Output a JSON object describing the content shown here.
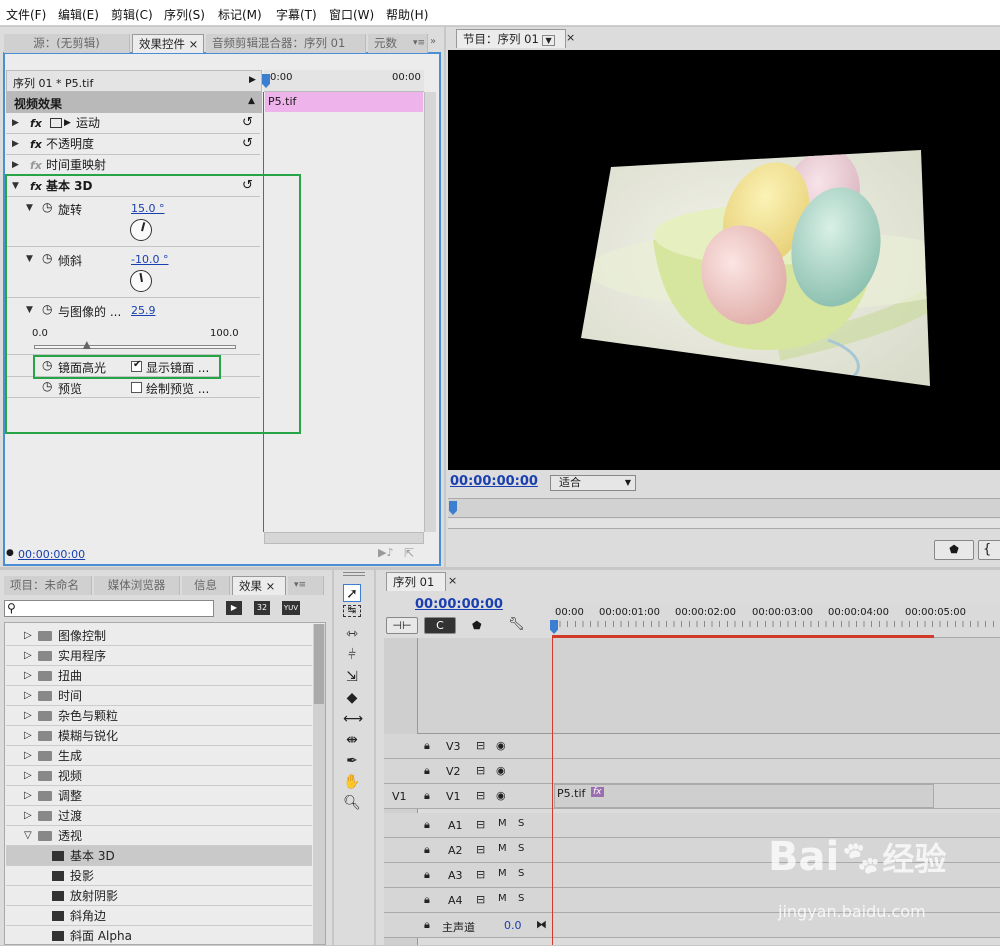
{
  "menu": [
    "文件(F)",
    "编辑(E)",
    "剪辑(C)",
    "序列(S)",
    "标记(M)",
    "字幕(T)",
    "窗口(W)",
    "帮助(H)"
  ],
  "source_tabs": {
    "source": "源：(无剪辑)",
    "effect_controls": "效果控件",
    "audio_mixer": "音频剪辑混合器：序列 01",
    "meta": "元数"
  },
  "ec": {
    "header": "序列 01 * P5.tif",
    "time_start": "0:00",
    "time_end": "00:00",
    "clip_label": "P5.tif",
    "section": "视频效果",
    "motion": "运动",
    "opacity": "不透明度",
    "time_remap": "时间重映射",
    "basic3d": "基本 3D",
    "rotate_label": "旋转",
    "rotate_val": "15.0 °",
    "tilt_label": "倾斜",
    "tilt_val": "-10.0 °",
    "distance_label": "与图像的 ...",
    "distance_val": "25.9",
    "slider_min": "0.0",
    "slider_max": "100.0",
    "slider_level": 0.259,
    "specular_label": "镜面高光",
    "specular_opt": "显示镜面 ...",
    "preview_label": "预览",
    "preview_opt": "绘制预览 ...",
    "timecode": "00:00:00:00"
  },
  "program": {
    "tab": "节目：序列 01",
    "timecode": "00:00:00:00",
    "fit": "适合"
  },
  "project_tabs": {
    "project": "项目：未命名",
    "media": "媒体浏览器",
    "info": "信息",
    "effects": "效果"
  },
  "effects_badges": [
    "32",
    "YUV"
  ],
  "effects_list": [
    "图像控制",
    "实用程序",
    "扭曲",
    "时间",
    "杂色与颗粒",
    "模糊与锐化",
    "生成",
    "视频",
    "调整",
    "过渡",
    "透视"
  ],
  "effects_sub": [
    "基本 3D",
    "投影",
    "放射阴影",
    "斜角边",
    "斜面 Alpha"
  ],
  "timeline": {
    "tab": "序列 01",
    "timecode": "00:00:00:00",
    "ruler": [
      "00:00",
      "00:00:01:00",
      "00:00:02:00",
      "00:00:03:00",
      "00:00:04:00",
      "00:00:05:00"
    ],
    "v_tracks": [
      "V3",
      "V2",
      "V1"
    ],
    "a_tracks": [
      "A1",
      "A2",
      "A3",
      "A4"
    ],
    "src_v": "V1",
    "master": "主声道",
    "master_val": "0.0",
    "clip": "P5.tif",
    "fx": "fx",
    "m": "M",
    "s": "S"
  },
  "watermark": {
    "brand": "Bai",
    "brand2": "经验",
    "url": "jingyan.baidu.com"
  },
  "colors": {
    "accent": "#27a546",
    "clip_pink": "#eeb3ea",
    "link": "#1a3fb0",
    "playhead": "#d23b2a"
  }
}
